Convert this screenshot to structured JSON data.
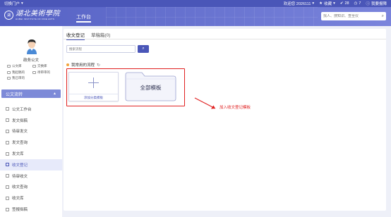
{
  "topbar": {
    "portal_switch": "切换门户",
    "welcome": "欢迎您 2026111",
    "favorites": "收藏",
    "message_count": "28",
    "todo_count": "7",
    "feedback": "我要报障"
  },
  "header": {
    "logo_seal": "湖",
    "logo_cn": "湖北美術學院",
    "logo_en": "HUBEI INSTITUTE OF FINE ARTS",
    "workspace_tab": "工作台",
    "search_placeholder": "找人、搜知识、查全仪"
  },
  "sidebar": {
    "username": "政务公文",
    "quick_links": [
      "公文库",
      "交换库",
      "我起稿的",
      "待审审的",
      "我已审的"
    ],
    "section_title": "公文流转",
    "items": [
      {
        "label": "公文工作台",
        "active": false
      },
      {
        "label": "发文拟稿",
        "active": false
      },
      {
        "label": "待审发文",
        "active": false
      },
      {
        "label": "发文查询",
        "active": false
      },
      {
        "label": "发文库",
        "active": false
      },
      {
        "label": "收文登记",
        "active": true
      },
      {
        "label": "待审收文",
        "active": false
      },
      {
        "label": "收文查询",
        "active": false
      },
      {
        "label": "收文库",
        "active": false
      },
      {
        "label": "签报拟稿",
        "active": false
      }
    ]
  },
  "main": {
    "tabs": [
      {
        "label": "收文登记",
        "active": true
      },
      {
        "label": "草稿箱(0)",
        "active": false
      }
    ],
    "search_placeholder": "搜索流程",
    "common_title": "我常用的流程",
    "add_card_label": "添加分类模板",
    "all_templates_label": "全部模板"
  },
  "annotation": {
    "text": "加入收文登记模板"
  },
  "colors": {
    "brand": "#4a56b8",
    "annotation_red": "#e02020"
  }
}
